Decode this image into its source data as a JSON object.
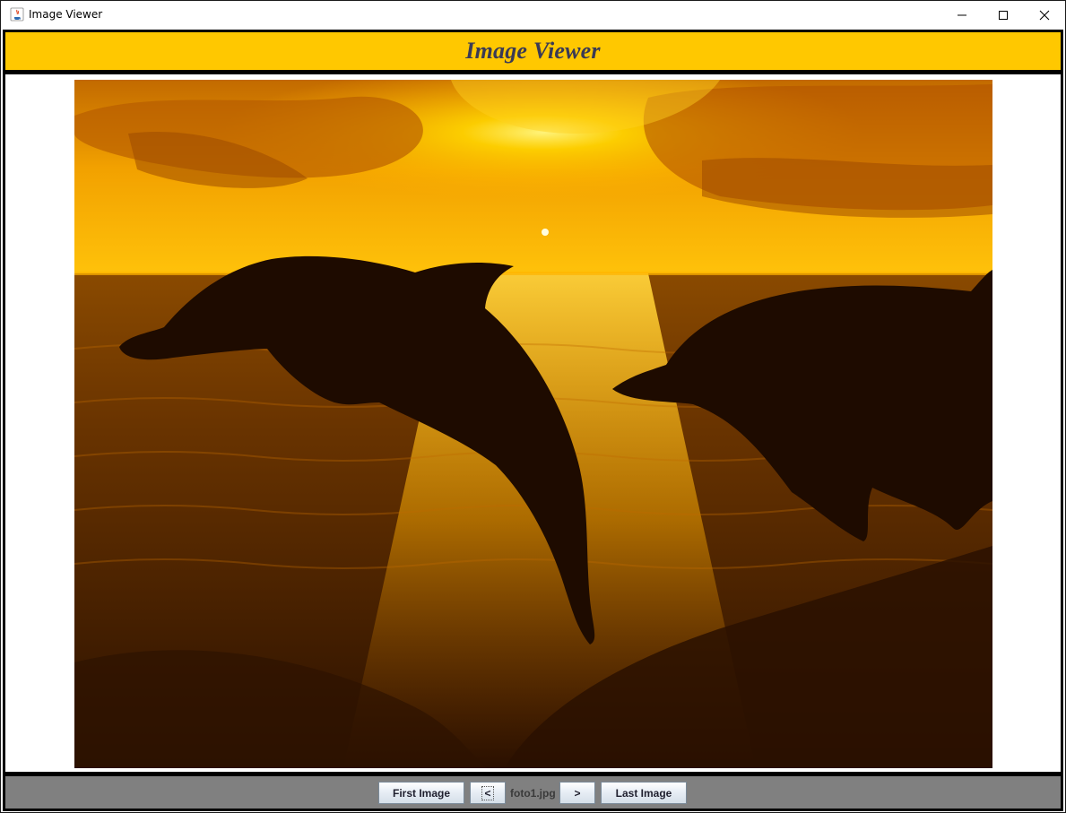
{
  "window": {
    "title": "Image Viewer"
  },
  "header": {
    "title": "Image Viewer",
    "background_color": "#ffc800"
  },
  "viewer": {
    "image_icon": "sunset-dolphins-photo"
  },
  "footer": {
    "first_label": "First Image",
    "prev_label": "<",
    "current_file": "foto1.jpg",
    "next_label": ">",
    "last_label": "Last Image",
    "background_color": "#808080"
  }
}
